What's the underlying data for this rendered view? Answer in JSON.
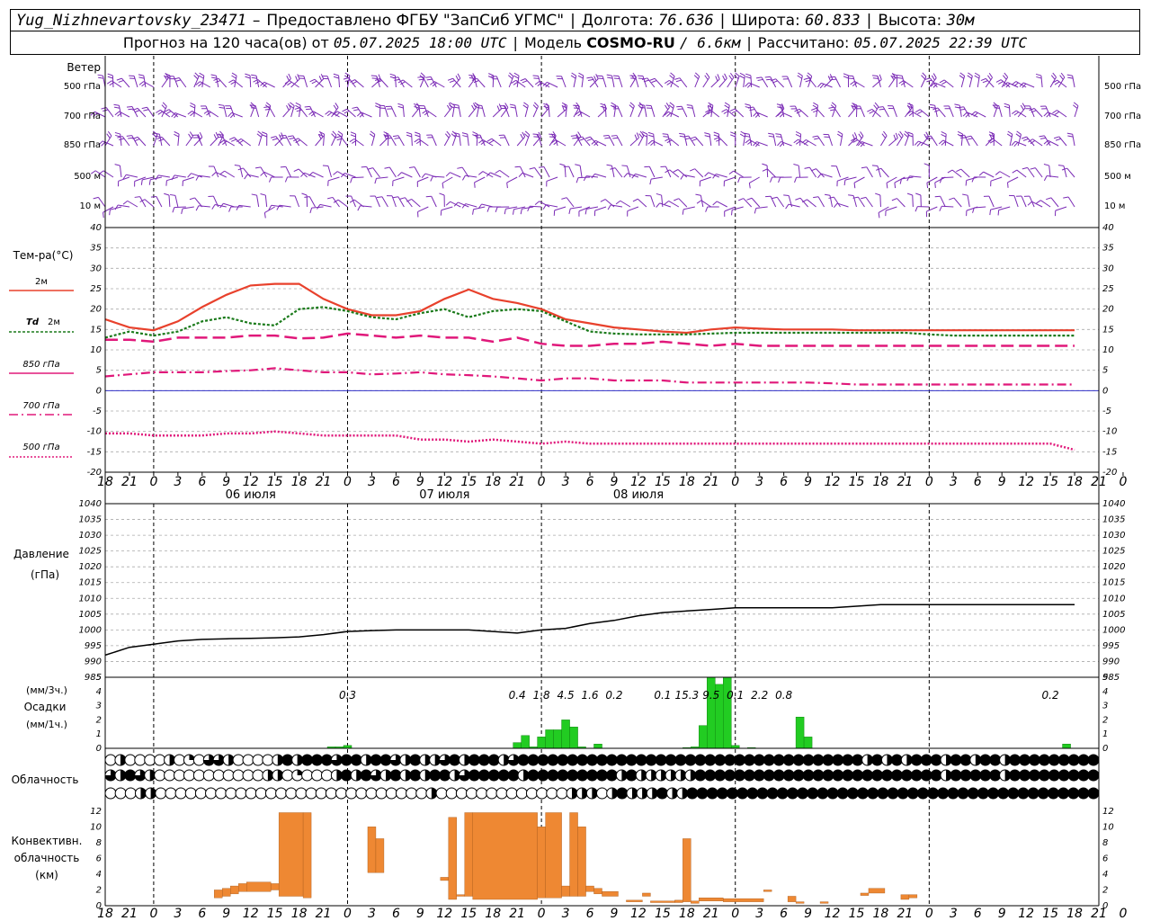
{
  "header": {
    "station": "Yug_Nizhnevartovsky_23471",
    "dash": "–",
    "provider": "Предоставлено ФГБУ \"ЗапСиб УГМС\"",
    "lon_label": "Долгота:",
    "lon": "76.636",
    "lat_label": "Широта:",
    "lat": "60.833",
    "alt_label": "Высота:",
    "alt": "30м",
    "forecast_prefix": "Прогноз на 120 часа(ов) от",
    "forecast_from": "05.07.2025 18:00 UTC",
    "model_label": "Модель",
    "model": "COSMO-RU",
    "resolution": "/ 6.6км",
    "calc_label": "Рассчитано:",
    "calc_time": "05.07.2025 22:39 UTC"
  },
  "labels": {
    "wind": "Ветер",
    "wind_levels": [
      "500 гПа",
      "700 гПа",
      "850 гПа",
      "500 м",
      "10  м"
    ],
    "temp_title": "Тем-ра(°C)",
    "legend_2m": "2м",
    "legend_td_a": "Td",
    "legend_td_b": "2м",
    "legend_850": "850 гПа",
    "legend_700": "700 гПа",
    "legend_500": "500 гПа",
    "pressure_title": "Давление",
    "pressure_unit": "(гПа)",
    "precip_unit3": "(мм/3ч.)",
    "precip_title": "Осадки",
    "precip_unit1": "(мм/1ч.)",
    "cloud_title": "Облачность",
    "conv_title_1": "Конвективн.",
    "conv_title_2": "облачность",
    "conv_unit": "(км)"
  },
  "colors": {
    "t2m": "#e8412c",
    "td2m": "#1a7a1a",
    "t850": "#e0187a",
    "t700": "#e0187a",
    "t500": "#e0187a",
    "wind": "#7a2ab5",
    "precip": "#22cc22",
    "conv": "#ee8833",
    "zero_line": "#3030c8"
  },
  "chart_data": [
    {
      "type": "line",
      "name": "temperature",
      "x_hours": [
        0,
        3,
        6,
        9,
        12,
        15,
        18,
        21,
        24,
        27,
        30,
        33,
        36,
        39,
        42,
        45,
        48,
        51,
        54,
        57,
        60,
        63,
        66,
        69,
        72,
        75,
        78,
        81,
        84,
        87,
        90,
        93,
        96,
        99,
        102,
        105,
        108,
        111,
        114,
        117,
        120
      ],
      "x_ticks": [
        "18",
        "21",
        "0",
        "3",
        "6",
        "9",
        "12",
        "15",
        "18",
        "21",
        "0",
        "3",
        "6",
        "9",
        "12",
        "15",
        "18",
        "21",
        "0",
        "3",
        "6",
        "9",
        "12",
        "15",
        "18",
        "21",
        "0",
        "3",
        "6",
        "9",
        "12",
        "15",
        "18",
        "21",
        "0",
        "3",
        "6",
        "9",
        "12",
        "15",
        "18",
        "21",
        "0"
      ],
      "day_labels": [
        "06 июля",
        "07 июля",
        "08 июля"
      ],
      "ylim": [
        -20,
        40
      ],
      "yticks": [
        -20,
        -15,
        -10,
        -5,
        0,
        5,
        10,
        15,
        20,
        25,
        30,
        35,
        40
      ],
      "series": [
        {
          "name": "2м",
          "values": [
            17.5,
            15.5,
            14.8,
            17,
            20.5,
            23.5,
            25.8,
            26.2,
            26.2,
            22.5,
            20,
            18.5,
            18.5,
            19.5,
            22.5,
            24.8,
            22.5,
            21.5,
            20,
            17.5,
            16.5,
            15.5,
            15,
            14.5,
            14.2,
            15,
            15.5,
            15.2,
            15,
            15,
            15,
            14.8,
            14.8,
            14.8,
            14.8,
            14.8,
            14.8,
            14.8,
            14.8,
            14.8,
            14.8
          ]
        },
        {
          "name": "Td 2м",
          "values": [
            13,
            14.5,
            13.5,
            14.5,
            17,
            18,
            16.5,
            16,
            20,
            20.5,
            19.5,
            18,
            17.5,
            19,
            20,
            18,
            19.5,
            20,
            19.5,
            17,
            14.5,
            14,
            13.8,
            13.8,
            13.8,
            14,
            14.2,
            14.2,
            14.2,
            14.2,
            14.2,
            14.2,
            14.2,
            14.2,
            13.8,
            13.5,
            13.5,
            13.5,
            13.5,
            13.5,
            13.5
          ]
        },
        {
          "name": "850 гПа",
          "values": [
            12.5,
            12.5,
            12,
            13,
            13,
            13,
            13.5,
            13.5,
            12.8,
            13,
            14,
            13.5,
            13,
            13.5,
            13,
            13,
            12,
            13,
            11.5,
            11,
            11,
            11.5,
            11.5,
            12,
            11.5,
            11,
            11.5,
            11,
            11,
            11,
            11,
            11,
            11,
            11,
            11,
            11,
            11,
            11,
            11,
            11,
            11
          ]
        },
        {
          "name": "700 гПа",
          "values": [
            3.5,
            4,
            4.5,
            4.5,
            4.5,
            4.8,
            5,
            5.5,
            5,
            4.5,
            4.5,
            4,
            4.2,
            4.5,
            4,
            3.8,
            3.5,
            3,
            2.5,
            3,
            3,
            2.5,
            2.5,
            2.5,
            2,
            2,
            2,
            2,
            2,
            2,
            1.8,
            1.5,
            1.5,
            1.5,
            1.5,
            1.5,
            1.5,
            1.5,
            1.5,
            1.5,
            1.5
          ]
        },
        {
          "name": "500 гПа",
          "values": [
            -10.5,
            -10.5,
            -11,
            -11,
            -11,
            -10.5,
            -10.5,
            -10,
            -10.5,
            -11,
            -11,
            -11,
            -11,
            -12,
            -12,
            -12.5,
            -12,
            -12.5,
            -13,
            -12.5,
            -13,
            -13,
            -13,
            -13,
            -13,
            -13,
            -13,
            -13,
            -13,
            -13,
            -13,
            -13,
            -13,
            -13,
            -13,
            -13,
            -13,
            -13,
            -13,
            -13,
            -14.5
          ]
        }
      ]
    },
    {
      "type": "line",
      "name": "pressure",
      "ylim": [
        985,
        1040
      ],
      "yticks": [
        985,
        990,
        995,
        1000,
        1005,
        1010,
        1015,
        1020,
        1025,
        1030,
        1035,
        1040
      ],
      "x_hours": [
        0,
        3,
        6,
        9,
        12,
        15,
        18,
        21,
        24,
        27,
        30,
        33,
        36,
        39,
        42,
        45,
        48,
        51,
        54,
        57,
        60,
        63,
        66,
        69,
        72,
        75,
        78,
        81,
        84,
        87,
        90,
        93,
        96,
        99,
        102,
        105,
        108,
        111,
        114,
        117,
        120
      ],
      "series": [
        {
          "name": "pressure",
          "values": [
            992,
            994.5,
            995.5,
            996.5,
            997,
            997.2,
            997.3,
            997.5,
            997.8,
            998.5,
            999.5,
            999.8,
            1000,
            1000,
            1000,
            1000,
            999.5,
            999,
            1000,
            1000.5,
            1002,
            1003,
            1004.5,
            1005.5,
            1006,
            1006.5,
            1007,
            1007,
            1007,
            1007,
            1007,
            1007.5,
            1008,
            1008,
            1008,
            1008,
            1008,
            1008,
            1008,
            1008,
            1008
          ]
        }
      ]
    },
    {
      "type": "bar",
      "name": "precipitation",
      "ylim": [
        0,
        5
      ],
      "yticks": [
        0,
        1,
        2,
        3,
        4,
        5
      ],
      "hourly_bars": [
        {
          "hour": 28,
          "value": 0.1
        },
        {
          "hour": 29,
          "value": 0.1
        },
        {
          "hour": 30,
          "value": 0.2
        },
        {
          "hour": 51,
          "value": 0.4
        },
        {
          "hour": 52,
          "value": 0.9
        },
        {
          "hour": 53,
          "value": 0.1
        },
        {
          "hour": 54,
          "value": 0.8
        },
        {
          "hour": 55,
          "value": 1.3
        },
        {
          "hour": 56,
          "value": 1.3
        },
        {
          "hour": 57,
          "value": 2.0
        },
        {
          "hour": 58,
          "value": 1.5
        },
        {
          "hour": 59,
          "value": 0.1
        },
        {
          "hour": 61,
          "value": 0.3
        },
        {
          "hour": 72,
          "value": 0.05
        },
        {
          "hour": 73,
          "value": 0.1
        },
        {
          "hour": 74,
          "value": 1.6
        },
        {
          "hour": 75,
          "value": 5.0
        },
        {
          "hour": 76,
          "value": 4.5
        },
        {
          "hour": 77,
          "value": 5.0
        },
        {
          "hour": 78,
          "value": 0.2
        },
        {
          "hour": 80,
          "value": 0.05
        },
        {
          "hour": 86,
          "value": 2.2
        },
        {
          "hour": 87,
          "value": 0.8
        },
        {
          "hour": 119,
          "value": 0.3
        }
      ],
      "three_hour_totals": [
        {
          "hour": 30,
          "label": "0.3"
        },
        {
          "hour": 51,
          "label": "0.4"
        },
        {
          "hour": 54,
          "label": "1.8"
        },
        {
          "hour": 57,
          "label": "4.5"
        },
        {
          "hour": 60,
          "label": "1.6"
        },
        {
          "hour": 63,
          "label": "0.2"
        },
        {
          "hour": 69,
          "label": "0.1"
        },
        {
          "hour": 72,
          "label": "15.3"
        },
        {
          "hour": 75,
          "label": "9.5"
        },
        {
          "hour": 78,
          "label": "0.1"
        },
        {
          "hour": 81,
          "label": "2.2"
        },
        {
          "hour": 84,
          "label": "0.8"
        },
        {
          "hour": 117,
          "label": "0.2"
        }
      ]
    },
    {
      "type": "table",
      "name": "cloudiness",
      "legend": "each circle: fraction filled = cloud cover; rows = high, middle, low",
      "row_high": [
        0,
        0.5,
        0,
        0,
        0,
        0,
        0.5,
        0,
        0.25,
        0,
        0.75,
        0.75,
        0.5,
        0,
        0,
        0,
        0,
        0.5,
        1,
        0.5,
        1,
        1,
        1,
        0.75,
        1,
        1,
        0.5,
        1,
        1,
        0.75,
        0.5,
        1,
        0.5,
        0.5,
        0.75,
        1,
        0.5,
        1,
        1,
        1,
        0.5,
        0.75,
        1,
        1,
        1,
        1,
        1,
        1,
        1,
        1,
        1,
        1,
        1,
        1,
        1,
        1,
        1,
        1,
        1,
        1,
        1,
        1,
        1,
        1,
        1,
        1,
        1,
        1,
        1,
        1,
        1,
        1,
        1,
        1,
        1,
        1,
        1,
        0.5,
        1,
        0.5,
        1,
        0.5,
        1,
        1,
        1,
        0.5,
        1,
        1,
        0.5,
        1,
        1,
        0.5,
        1,
        1,
        1,
        1,
        1,
        1,
        1,
        1,
        1
      ],
      "row_mid": [
        0.75,
        0.5,
        1,
        0.75,
        0.5,
        0,
        0,
        0,
        0,
        0,
        0,
        0,
        0,
        0,
        0,
        0,
        0.5,
        0.5,
        0,
        0.25,
        0,
        0,
        0,
        0.5,
        1,
        0.5,
        1,
        0.75,
        0.5,
        1,
        0.5,
        1,
        0.5,
        1,
        1,
        0.5,
        0.75,
        1,
        1,
        1,
        1,
        1,
        0.5,
        1,
        1,
        1,
        1,
        1,
        1,
        1,
        1,
        1,
        0.5,
        1,
        0.5,
        0.5,
        0.5,
        0.5,
        0.5,
        0.5,
        1,
        1,
        1,
        1,
        1,
        1,
        1,
        1,
        1,
        1,
        1,
        1,
        1,
        1,
        1,
        1,
        1,
        1,
        1,
        1,
        1,
        1,
        1,
        1,
        1,
        0.5,
        1,
        1,
        1,
        1,
        1,
        0.5,
        1,
        1,
        1,
        1,
        1,
        1,
        1,
        1,
        1
      ],
      "row_low": [
        0,
        0,
        0,
        0.5,
        0.5,
        0,
        0,
        0,
        0,
        0,
        0,
        0,
        0,
        0,
        0,
        0,
        0,
        0,
        0,
        0,
        0,
        0,
        0,
        0,
        0,
        0,
        0,
        0,
        0,
        0,
        0,
        0,
        0.5,
        0,
        0,
        0,
        0,
        0,
        0,
        0,
        0,
        0,
        0,
        0,
        0,
        0,
        0.5,
        0.5,
        0.5,
        0,
        0.5,
        1,
        0.5,
        0.5,
        0.5,
        1,
        0.5,
        0.5,
        1,
        1,
        1,
        1,
        1,
        1,
        1,
        1,
        1,
        1,
        1,
        1,
        1,
        1,
        1,
        1,
        1,
        1,
        1,
        1,
        1,
        1,
        1,
        1,
        1,
        1,
        1,
        1,
        1,
        1,
        1,
        1,
        1,
        1,
        1,
        1,
        1,
        1,
        1,
        1,
        1
      ]
    },
    {
      "type": "bar",
      "name": "convective_cloud",
      "ylim": [
        0,
        13
      ],
      "yticks": [
        0,
        2,
        4,
        6,
        8,
        10,
        12
      ],
      "bars": [
        {
          "h0": 14,
          "h1": 15,
          "bottom": 1.0,
          "top": 2.0
        },
        {
          "h0": 15,
          "h1": 16,
          "bottom": 1.2,
          "top": 2.2
        },
        {
          "h0": 16,
          "h1": 17,
          "bottom": 1.5,
          "top": 2.5
        },
        {
          "h0": 17,
          "h1": 18,
          "bottom": 1.8,
          "top": 2.8
        },
        {
          "h0": 18,
          "h1": 21,
          "bottom": 1.8,
          "top": 3.0
        },
        {
          "h0": 21,
          "h1": 22,
          "bottom": 2.0,
          "top": 2.8
        },
        {
          "h0": 22,
          "h1": 25,
          "bottom": 1.2,
          "top": 11.8
        },
        {
          "h0": 25,
          "h1": 26,
          "bottom": 1.0,
          "top": 11.8
        },
        {
          "h0": 33,
          "h1": 34,
          "bottom": 4.2,
          "top": 10.0
        },
        {
          "h0": 34,
          "h1": 35,
          "bottom": 4.2,
          "top": 8.5
        },
        {
          "h0": 42,
          "h1": 43,
          "bottom": 3.2,
          "top": 3.6
        },
        {
          "h0": 43,
          "h1": 44,
          "bottom": 0.8,
          "top": 11.2
        },
        {
          "h0": 44,
          "h1": 45,
          "bottom": 1.2,
          "top": 1.4
        },
        {
          "h0": 45,
          "h1": 46,
          "bottom": 1.2,
          "top": 11.8
        },
        {
          "h0": 46,
          "h1": 54,
          "bottom": 0.8,
          "top": 11.8
        },
        {
          "h0": 54,
          "h1": 55,
          "bottom": 1.0,
          "top": 10.0
        },
        {
          "h0": 55,
          "h1": 57,
          "bottom": 1.0,
          "top": 11.8
        },
        {
          "h0": 57,
          "h1": 58,
          "bottom": 1.2,
          "top": 2.5
        },
        {
          "h0": 58,
          "h1": 59,
          "bottom": 1.2,
          "top": 11.8
        },
        {
          "h0": 59,
          "h1": 60,
          "bottom": 1.2,
          "top": 10.0
        },
        {
          "h0": 60,
          "h1": 61,
          "bottom": 1.8,
          "top": 2.5
        },
        {
          "h0": 61,
          "h1": 62,
          "bottom": 1.5,
          "top": 2.2
        },
        {
          "h0": 62,
          "h1": 64,
          "bottom": 1.2,
          "top": 1.8
        },
        {
          "h0": 65,
          "h1": 67,
          "bottom": 0.5,
          "top": 0.7
        },
        {
          "h0": 67,
          "h1": 68,
          "bottom": 1.2,
          "top": 1.6
        },
        {
          "h0": 68,
          "h1": 71,
          "bottom": 0.4,
          "top": 0.6
        },
        {
          "h0": 71,
          "h1": 72,
          "bottom": 0.4,
          "top": 0.7
        },
        {
          "h0": 72,
          "h1": 73,
          "bottom": 0.5,
          "top": 8.5
        },
        {
          "h0": 73,
          "h1": 74,
          "bottom": 0.3,
          "top": 0.6
        },
        {
          "h0": 74,
          "h1": 77,
          "bottom": 0.6,
          "top": 1.0
        },
        {
          "h0": 77,
          "h1": 82,
          "bottom": 0.5,
          "top": 0.9
        },
        {
          "h0": 82,
          "h1": 83,
          "bottom": 1.8,
          "top": 2.0
        },
        {
          "h0": 85,
          "h1": 86,
          "bottom": 0.5,
          "top": 1.2
        },
        {
          "h0": 86,
          "h1": 87,
          "bottom": 0.3,
          "top": 0.5
        },
        {
          "h0": 89,
          "h1": 90,
          "bottom": 0.3,
          "top": 0.5
        },
        {
          "h0": 94,
          "h1": 95,
          "bottom": 1.3,
          "top": 1.6
        },
        {
          "h0": 95,
          "h1": 97,
          "bottom": 1.6,
          "top": 2.2
        },
        {
          "h0": 99,
          "h1": 100,
          "bottom": 0.8,
          "top": 1.4
        },
        {
          "h0": 100,
          "h1": 101,
          "bottom": 1.0,
          "top": 1.4
        }
      ]
    }
  ]
}
